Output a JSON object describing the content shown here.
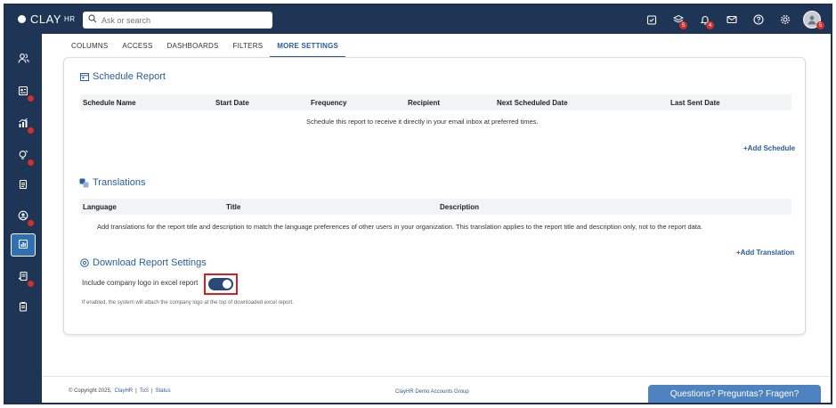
{
  "app": {
    "logo_text": "CLAY",
    "logo_suffix": "HR"
  },
  "search": {
    "placeholder": "Ask or search"
  },
  "topbar": {
    "icons": [
      {
        "name": "clipboard-check-icon",
        "badge": ""
      },
      {
        "name": "layers-icon",
        "badge": "5"
      },
      {
        "name": "bell-icon",
        "badge": "4"
      },
      {
        "name": "mail-icon",
        "badge": ""
      },
      {
        "name": "help-icon",
        "badge": ""
      },
      {
        "name": "gear-icon",
        "badge": ""
      }
    ],
    "avatar_badge": "5"
  },
  "tabs": [
    "COLUMNS",
    "ACCESS",
    "DASHBOARDS",
    "FILTERS",
    "MORE SETTINGS"
  ],
  "schedule": {
    "title": "Schedule Report",
    "columns": [
      "Schedule Name",
      "Start Date",
      "Frequency",
      "Recipient",
      "Next Scheduled Date",
      "Last Sent Date"
    ],
    "empty_message": "Schedule this report to receive it directly in your email inbox at preferred times.",
    "add_label": "+Add Schedule"
  },
  "translations": {
    "title": "Translations",
    "columns": [
      "Language",
      "Title",
      "Description"
    ],
    "empty_message": "Add translations for the report title and description to match the language preferences of other users in your organization. This translation applies to the report title and description only, not to the report data.",
    "add_label": "+Add Translation"
  },
  "download": {
    "title": "Download Report Settings",
    "toggle_label": "Include company logo in excel report",
    "toggle_on": true,
    "hint": "If enabled, the system will attach the company logo at the top of downloaded excel report."
  },
  "footer": {
    "copyright": "© Copyright 2025,",
    "brand_link": "ClayHR",
    "sep1": "|",
    "tos": "ToS",
    "sep2": "|",
    "status": "Status",
    "group": "ClayHR Demo Accounts Group",
    "chat": "Questions? Preguntas? Fragen?"
  },
  "colors": {
    "nav": "#1e3555",
    "accent": "#2a5d9a",
    "badge": "#d0312d"
  }
}
